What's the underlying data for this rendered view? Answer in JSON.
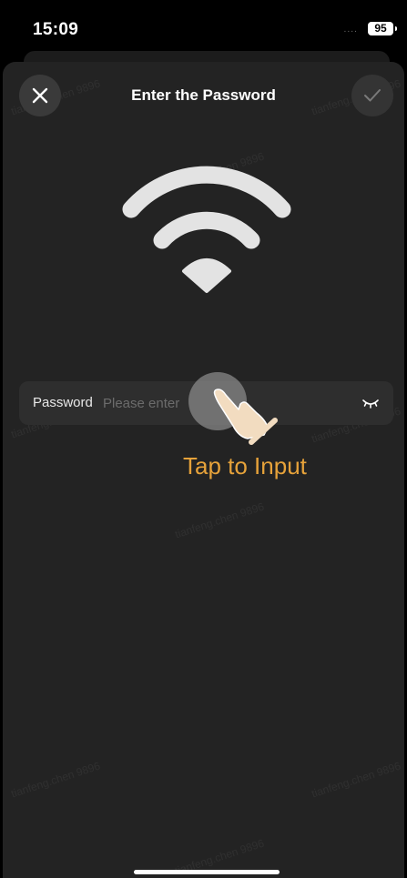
{
  "status_bar": {
    "time": "15:09",
    "signal": "....",
    "battery": "95"
  },
  "sheet": {
    "title": "Enter the Password",
    "close_icon": "close-icon",
    "confirm_icon": "checkmark-icon"
  },
  "wifi_icon": "wifi-icon",
  "password_field": {
    "label": "Password",
    "placeholder": "Please enter",
    "value": "",
    "toggle_icon": "eye-closed-icon"
  },
  "tap_hint": {
    "text": "Tap to Input",
    "icon": "pointing-hand-icon"
  },
  "watermark": {
    "text": "tianfeng.chen 9896"
  },
  "colors": {
    "sheet_background": "#232323",
    "field_background": "#2e2e2e",
    "hint_text": "#e6a23a",
    "wifi_icon": "#e3e3e3"
  }
}
